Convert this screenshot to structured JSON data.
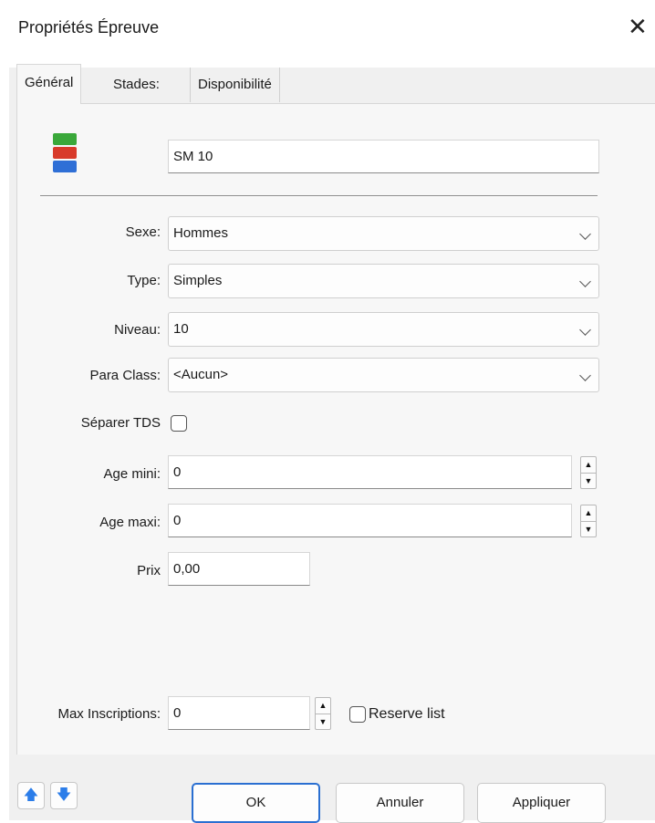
{
  "window": {
    "title": "Propriétés Épreuve",
    "close_glyph": "✕"
  },
  "tabs": [
    {
      "label": "Général",
      "active": true
    },
    {
      "label": "Stades:",
      "active": false
    },
    {
      "label": "Disponibilité",
      "active": false
    }
  ],
  "event": {
    "icon": "stacked-layers-icon",
    "name": "SM 10"
  },
  "fields": {
    "sexe": {
      "label": "Sexe:",
      "value": "Hommes"
    },
    "type": {
      "label": "Type:",
      "value": "Simples"
    },
    "niveau": {
      "label": "Niveau:",
      "value": "10"
    },
    "para_class": {
      "label": "Para Class:",
      "value": "<Aucun>"
    },
    "separer_tds": {
      "label": "Séparer TDS",
      "checked": false
    },
    "age_mini": {
      "label": "Age mini:",
      "value": "0"
    },
    "age_maxi": {
      "label": "Age maxi:",
      "value": "0"
    },
    "prix": {
      "label": "Prix",
      "value": "0,00"
    },
    "max_inscriptions": {
      "label": "Max Inscriptions:",
      "value": "0"
    },
    "reserve_list": {
      "label": "Reserve list",
      "checked": false
    }
  },
  "buttons": {
    "ok": "OK",
    "annuler": "Annuler",
    "appliquer": "Appliquer"
  },
  "icon_glyphs": {
    "up": "🡅",
    "down": "🡇",
    "spin_up": "▲",
    "spin_down": "▼"
  },
  "colors": {
    "accent": "#2a6fd1",
    "arrow_blue": "#2b7de9",
    "layer_green": "#3aa83a",
    "layer_red": "#d83a2a",
    "layer_blue": "#2f6fd6"
  }
}
